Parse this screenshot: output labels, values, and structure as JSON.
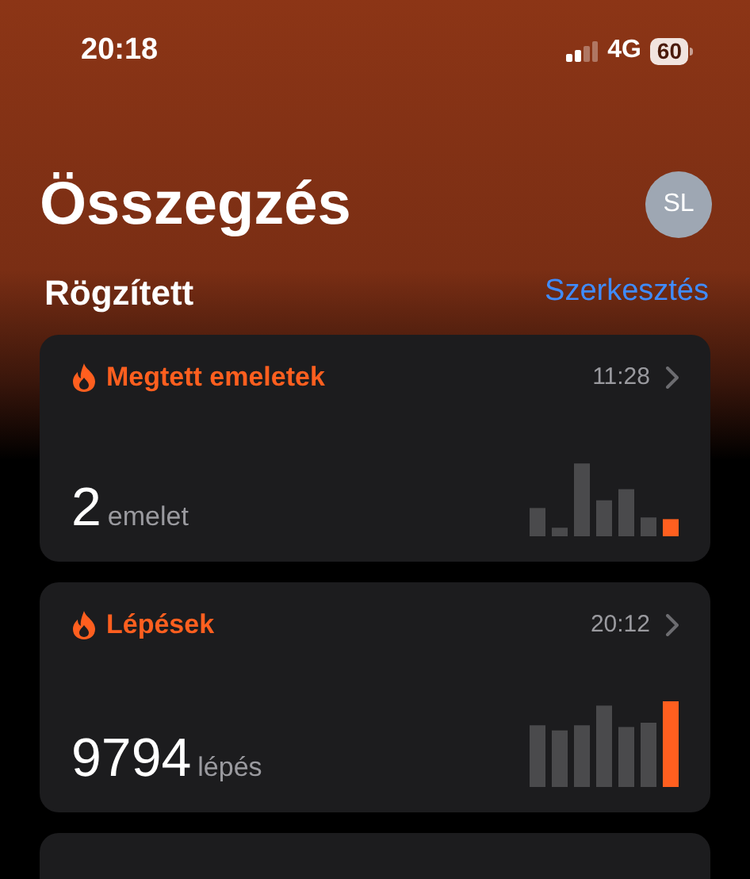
{
  "status_bar": {
    "time": "20:18",
    "network": "4G",
    "battery": "60"
  },
  "title": "Összegzés",
  "avatar": {
    "initials": "SL"
  },
  "section": {
    "title": "Rögzített",
    "action": "Szerkesztés"
  },
  "cards": [
    {
      "title": "Megtett emeletek",
      "time": "11:28",
      "value": "2",
      "unit": "emelet"
    },
    {
      "title": "Lépések",
      "time": "20:12",
      "value": "9794",
      "unit": "lépés"
    },
    {
      "kind": "partial"
    }
  ]
}
